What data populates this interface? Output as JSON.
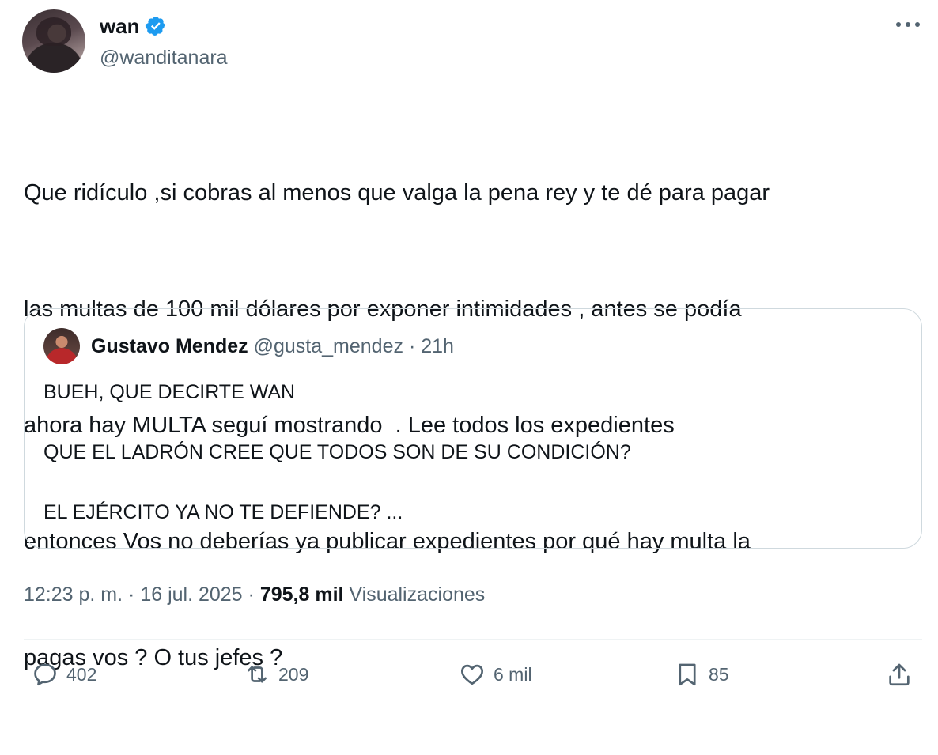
{
  "author": {
    "name": "wan",
    "handle": "@wanditanara",
    "verified": true,
    "verified_color": "#1d9bf0",
    "avatar_icon": "profile-photo"
  },
  "tweet": {
    "text_lines": [
      "Que ridículo ,si cobras al menos que valga la pena rey y te dé para pagar",
      "las multas de 100 mil dólares por exponer intimidades , antes se podía",
      "ahora hay MULTA seguí mostrando  . Lee todos los expedientes",
      "entonces Vos no deberías ya publicar expedientes por qué hay multa la",
      "pagas vos ? O tus jefes ?"
    ]
  },
  "quote": {
    "name": "Gustavo Mendez",
    "handle": "@gusta_mendez",
    "separator": "·",
    "time": "21h",
    "lines": [
      "BUEH, QUE DECIRTE WAN",
      "QUE EL LADRÓN CREE QUE TODOS SON DE SU CONDICIÓN?",
      "EL EJÉRCITO YA NO TE DEFIENDE? ..."
    ]
  },
  "meta": {
    "time": "12:23 p. m.",
    "separator": "·",
    "date": "16 jul. 2025",
    "views_count": "795,8 mil",
    "views_label": "Visualizaciones"
  },
  "actions": {
    "replies": "402",
    "reposts": "209",
    "likes": "6 mil",
    "bookmarks": "85"
  },
  "colors": {
    "text": "#0f1419",
    "secondary": "#536471",
    "border": "#cfd9de",
    "accent": "#1d9bf0"
  }
}
